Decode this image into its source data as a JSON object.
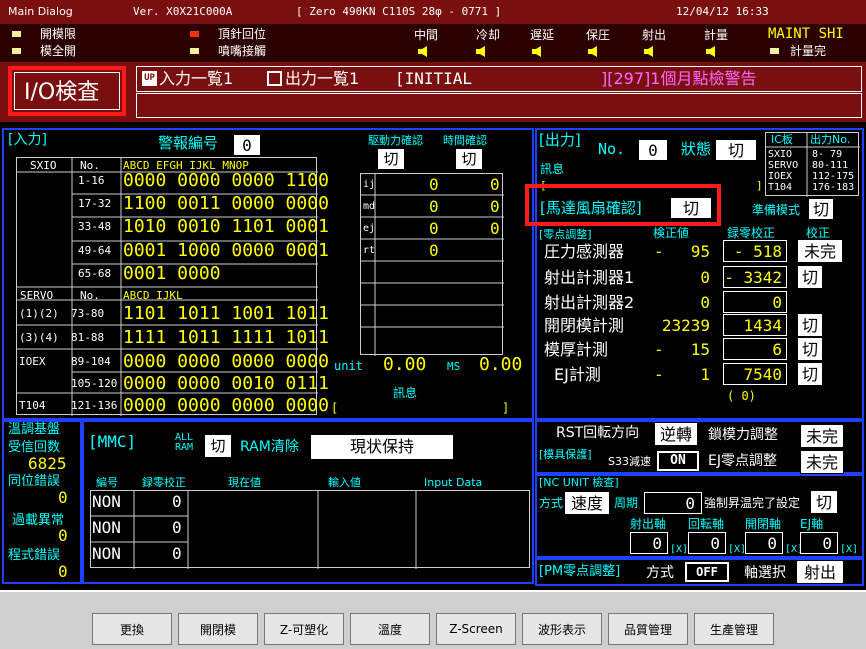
{
  "titlebar": {
    "title": "Main Dialog",
    "version": "Ver. X0X21C000A",
    "status": "[ Zero  490KN  C110S  28φ - 0771 ]",
    "datetime": "12/04/12 16:33"
  },
  "indicators": {
    "mold_limit": "開模限",
    "mold_open": "模全開",
    "ejector_return": "頂針回位",
    "nozzle_contact": "噴嘴接觸",
    "mid": "中間",
    "cooling": "冷却",
    "delay": "遅延",
    "hold": "保圧",
    "inject": "射出",
    "metering": "計量",
    "maint": "MAINT SHI",
    "metering_done": "計量完"
  },
  "alarm": {
    "screen_name": "I/O検査",
    "input_list": "入力一覧1",
    "output_list": "出力一覧1",
    "initial": "[INITIAL",
    "message": "][297]1個月點檢警告"
  },
  "input_panel": {
    "title": "[入力]",
    "alarm_no_label": "警報編号",
    "alarm_no": "0",
    "drive_confirm": "駆動力確認",
    "time_confirm": "時間確認",
    "drive_btn": "切",
    "time_btn": "切",
    "sxio": "SXIO",
    "no": "No.",
    "cols1": "ABCD  EFGH  IJKL  MNOP",
    "rows": [
      {
        "range": "1-16",
        "bits": "0000 0000 0000 1100"
      },
      {
        "range": "17-32",
        "bits": "1100 0011 0000 0000"
      },
      {
        "range": "33-48",
        "bits": "1010 0010 1101 0001"
      },
      {
        "range": "49-64",
        "bits": "0001 1000 0000 0001"
      },
      {
        "range": "65-68",
        "bits": "0001 0000"
      }
    ],
    "servo": "SERVO",
    "servo_no": "No.",
    "cols2": "ABCD            IJKL",
    "servo_rows": [
      {
        "label": "(1)(2)",
        "range": "73-80",
        "bits": "1101 1011 1001 1011"
      },
      {
        "label": "(3)(4)",
        "range": "81-88",
        "bits": "1111 1011 1111 1011"
      },
      {
        "label": "IOEX",
        "range": "89-104",
        "bits": "0000 0000 0000 0000"
      },
      {
        "label": "",
        "range": "105-120",
        "bits": "0000 0000 0010 0111"
      },
      {
        "label": "T104",
        "range": "121-136",
        "bits": "0000 0000 0000 0000"
      }
    ],
    "axis_rows": [
      {
        "label": "ij",
        "v1": "0",
        "v2": "0"
      },
      {
        "label": "md",
        "v1": "0",
        "v2": "0"
      },
      {
        "label": "ej",
        "v1": "0",
        "v2": "0"
      },
      {
        "label": "rt",
        "v1": "0",
        "v2": ""
      }
    ],
    "unit_label": "unit",
    "unit_value": "0.00",
    "ms_label": "MS",
    "ms_value": "0.00",
    "message_label": "訊息",
    "bracket_open": "[",
    "bracket_close": "]"
  },
  "output_panel": {
    "title": "[出力]",
    "no_label": "No.",
    "no_value": "0",
    "state_label": "狀態",
    "state_value": "切",
    "message_label": "訊息",
    "ic_header": "IC板",
    "out_header": "出力No.",
    "ic_rows": [
      {
        "board": "SXIO",
        "range": "8- 79"
      },
      {
        "board": "SERVO",
        "range": "80-111"
      },
      {
        "board": "IOEX",
        "range": "112-175"
      },
      {
        "board": "T104",
        "range": "176-183"
      }
    ],
    "fan_label": "[馬達風扇確認]",
    "fan_value": "切",
    "ready_label": "準備模式",
    "ready_value": "切",
    "zero_label": "[零点調整]",
    "detect_label": "検正値",
    "record_label": "録零校正",
    "calib_label": "校正",
    "sensors": [
      {
        "name": "圧力感測器",
        "dash": "-",
        "value": "95",
        "rec": "- 518",
        "state": "未完"
      },
      {
        "name": "射出計測器1",
        "dash": "",
        "value": "0",
        "rec": "- 3342",
        "state": "切"
      },
      {
        "name": "射出計測器2",
        "dash": "",
        "value": "0",
        "rec": "0",
        "state": ""
      },
      {
        "name": "開閉模計測",
        "dash": "",
        "value": "23239",
        "rec": "1434",
        "state": "切"
      },
      {
        "name": "模厚計測",
        "dash": "-",
        "value": "15",
        "rec": "6",
        "state": "切"
      },
      {
        "name": "EJ計測",
        "dash": "-",
        "value": "1",
        "rec": "7540",
        "state": "切"
      }
    ],
    "paren": "(        0)"
  },
  "temp_panel": {
    "title": "溫調基盤",
    "recv_label": "受信回数",
    "recv_value": "6825",
    "sync_label": "同位錯誤",
    "sync_value": "0",
    "overload_label": "過載異常",
    "overload_value": "0",
    "prog_label": "程式錯誤",
    "prog_value": "0"
  },
  "mmc_panel": {
    "title": "[MMC]",
    "all_ram": "ALL RAM",
    "ram_btn": "切",
    "ram_clear": "RAM清除",
    "keep": "現状保持",
    "col_no": "編号",
    "col_rec": "録零校正",
    "col_cur": "現在値",
    "col_in": "輸入値",
    "col_data": "Input Data",
    "rows": [
      {
        "no": "NON",
        "rec": "0"
      },
      {
        "no": "NON",
        "rec": "0"
      },
      {
        "no": "NON",
        "rec": "0"
      }
    ]
  },
  "right_bottom": {
    "rst_label": "RST回転方向",
    "rst_value": "逆轉",
    "lock_label": "鎖模力調整",
    "lock_value": "未完",
    "mold_protect": "[模具保護]",
    "s33": "S33減速",
    "s33_value": "ON",
    "ej_zero": "EJ零点調整",
    "ej_zero_value": "未完",
    "nc_title": "[NC UNIT 檢查]",
    "method_label": "方式",
    "method_value": "速度",
    "period_label": "周期",
    "period_value": "0",
    "force_label": "強制昇温完了設定",
    "force_value": "切",
    "axes": [
      {
        "name": "射出軸",
        "value": "0"
      },
      {
        "name": "回転軸",
        "value": "0"
      },
      {
        "name": "開閉軸",
        "value": "0"
      },
      {
        "name": "EJ軸",
        "value": "0"
      }
    ],
    "x_mark": "[X]",
    "pm_label": "[PM零点調整]",
    "pm_method": "方式",
    "pm_value": "OFF",
    "axis_sel": "軸選択",
    "axis_value": "射出"
  },
  "buttons": [
    "更換",
    "開閉模",
    "Z-可塑化",
    "溫度",
    "Z-Screen",
    "波形表示",
    "品質管理",
    "生產管理"
  ]
}
